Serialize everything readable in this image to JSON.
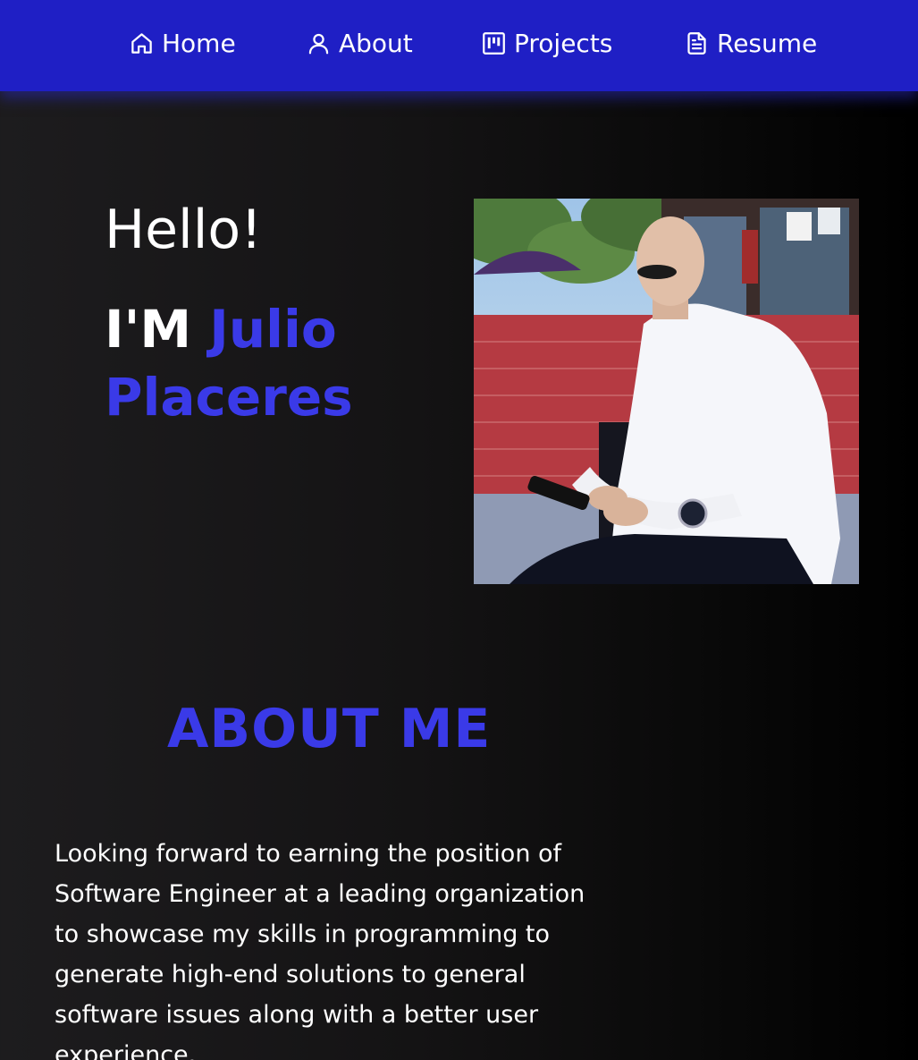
{
  "nav": {
    "items": [
      {
        "label": "Home",
        "icon": "home-icon"
      },
      {
        "label": "About",
        "icon": "user-icon"
      },
      {
        "label": "Projects",
        "icon": "kanban-icon"
      },
      {
        "label": "Resume",
        "icon": "document-icon"
      }
    ]
  },
  "hero": {
    "greeting": "Hello!",
    "intro_prefix": "I'M ",
    "name": "Julio Placeres"
  },
  "about": {
    "title": "ABOUT ME",
    "text": "Looking forward to earning the position of Software Engineer at a leading organization to showcase my skills in programming to generate high-end solutions to general software issues along with a better user experience."
  },
  "colors": {
    "navbar_bg": "#1f1fc5",
    "accent": "#3a3ae8",
    "page_bg": "#141314"
  }
}
